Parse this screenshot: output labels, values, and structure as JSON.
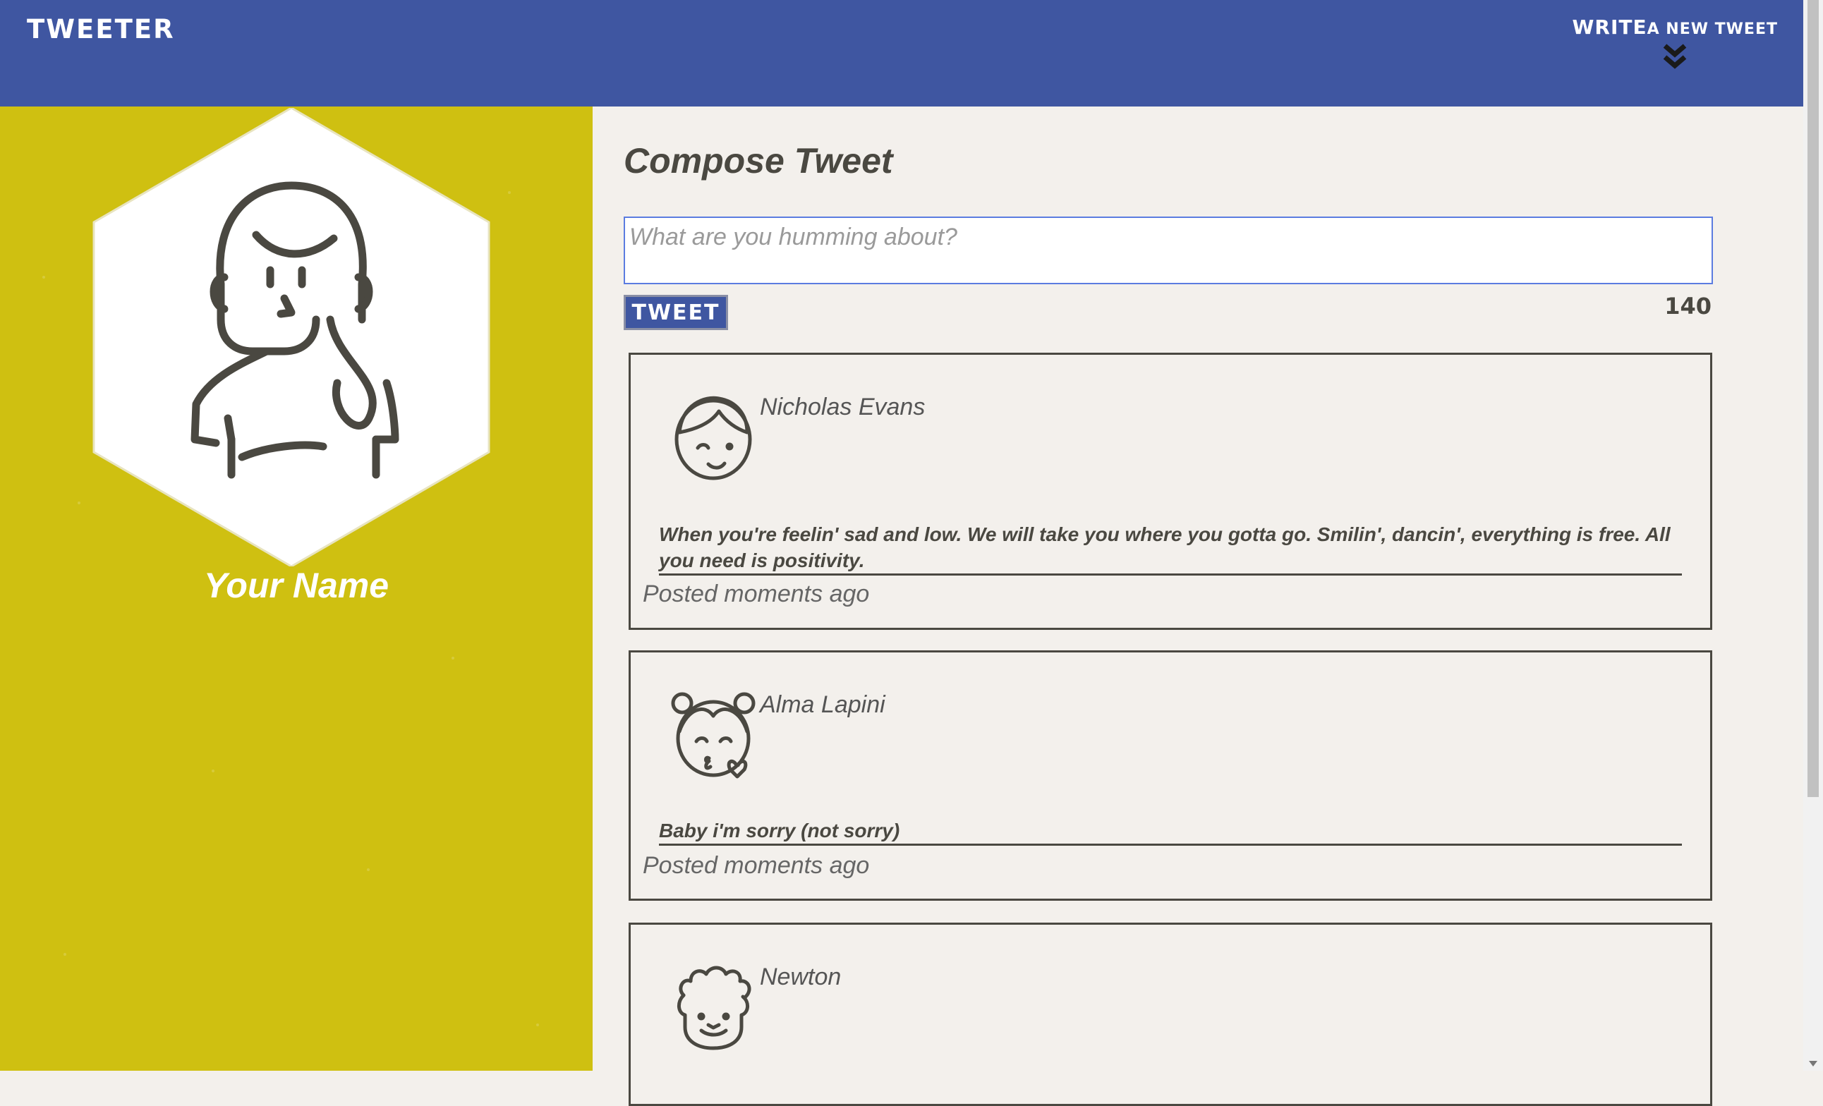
{
  "nav": {
    "brand": "Tweeter",
    "write_label": "Write",
    "new_tweet_label": "a new tweet"
  },
  "profile": {
    "name": "Your Name"
  },
  "compose": {
    "title": "Compose Tweet",
    "placeholder": "What are you humming about?",
    "button_label": "Tweet",
    "counter": "140"
  },
  "tweets": [
    {
      "author": "Nicholas Evans",
      "content": "When you're feelin' sad and low. We will take you where you gotta go. Smilin', dancin', everything is free. All you need is positivity.",
      "meta": "Posted moments ago",
      "avatar_icon": "boy-avatar-icon"
    },
    {
      "author": "Alma Lapini",
      "content": "Baby i'm sorry (not sorry)",
      "meta": "Posted moments ago",
      "avatar_icon": "girl-kiss-avatar-icon"
    },
    {
      "author": "Newton",
      "content": "",
      "meta": "",
      "avatar_icon": "curly-hair-avatar-icon"
    }
  ],
  "colors": {
    "nav": "#3f56a1",
    "sidebar": "#cfc011",
    "page_bg": "#f3f0ec",
    "text_dark": "#4a4841"
  }
}
